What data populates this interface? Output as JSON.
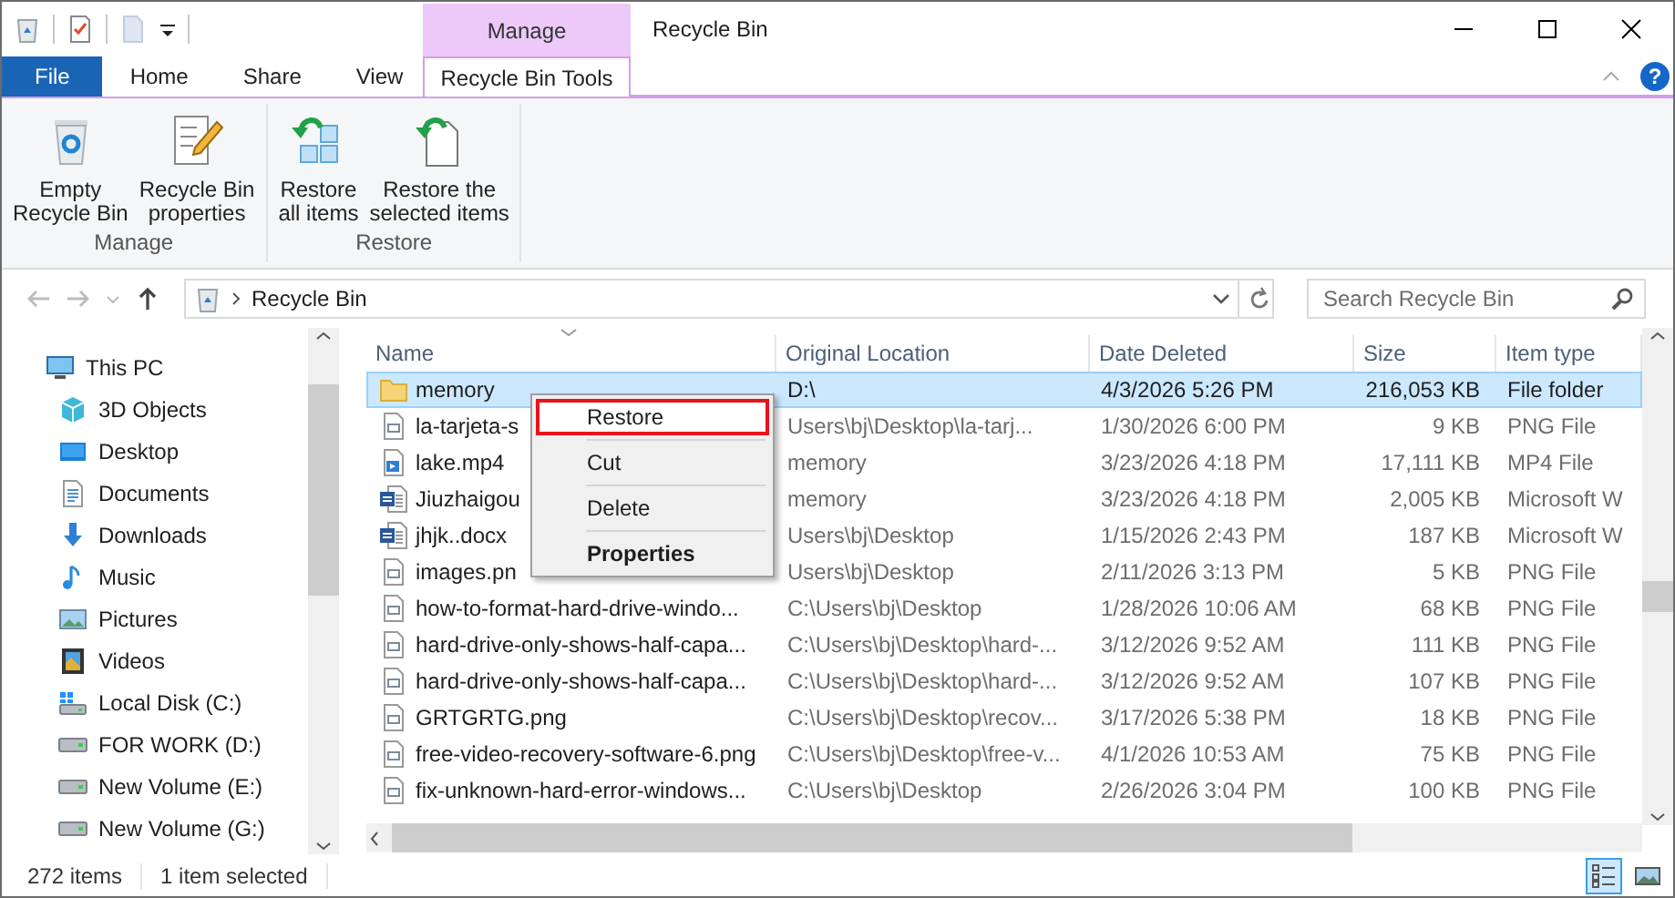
{
  "window": {
    "title": "Recycle Bin"
  },
  "ribbon_tabs": [
    {
      "label": "File",
      "kind": "file",
      "selected": false
    },
    {
      "label": "Home",
      "kind": "tab",
      "selected": false
    },
    {
      "label": "Share",
      "kind": "tab",
      "selected": false
    },
    {
      "label": "View",
      "kind": "tab",
      "selected": false
    }
  ],
  "contextual_tabs": {
    "header": "Manage",
    "tabs": [
      {
        "label": "Recycle Bin Tools",
        "selected": true
      }
    ]
  },
  "help": "?",
  "ribbon_groups": [
    {
      "label": "Manage",
      "buttons": [
        {
          "label": "Empty\nRecycle Bin",
          "kind": "empty"
        },
        {
          "label": "Recycle Bin\nproperties",
          "kind": "properties"
        }
      ]
    },
    {
      "label": "Restore",
      "buttons": [
        {
          "label": "Restore\nall items",
          "kind": "restore-all"
        },
        {
          "label": "Restore the\nselected items",
          "kind": "restore-selected"
        }
      ]
    }
  ],
  "address": {
    "path": "Recycle Bin"
  },
  "search": {
    "placeholder": "Search Recycle Bin"
  },
  "navigation": {
    "items": [
      {
        "label": "This PC",
        "kind": "computer",
        "children": [
          {
            "label": "3D Objects",
            "kind": "objects"
          },
          {
            "label": "Desktop",
            "kind": "desktop"
          },
          {
            "label": "Documents",
            "kind": "documents"
          },
          {
            "label": "Downloads",
            "kind": "downloads"
          },
          {
            "label": "Music",
            "kind": "music"
          },
          {
            "label": "Pictures",
            "kind": "pictures"
          },
          {
            "label": "Videos",
            "kind": "videos"
          },
          {
            "label": "Local Disk (C:)",
            "kind": "system-drive"
          },
          {
            "label": "FOR WORK (D:)",
            "kind": "drive"
          },
          {
            "label": "New Volume (E:)",
            "kind": "drive"
          },
          {
            "label": "New Volume (G:)",
            "kind": "drive"
          }
        ]
      }
    ]
  },
  "table": {
    "columns": [
      {
        "label": "Name",
        "kind": "text",
        "sorted": true
      },
      {
        "label": "Original Location",
        "kind": "text",
        "sorted": false
      },
      {
        "label": "Date Deleted",
        "kind": "text",
        "sorted": false
      },
      {
        "label": "Size",
        "kind": "number",
        "sorted": false
      },
      {
        "label": "Item type",
        "kind": "text",
        "sorted": false
      }
    ],
    "rows": [
      {
        "kind": "folder",
        "selected": true,
        "cells": [
          "memory",
          "D:\\",
          "4/3/2026 5:26 PM",
          "216,053 KB",
          "File folder"
        ]
      },
      {
        "kind": "image",
        "selected": false,
        "cells": [
          "la-tarjeta-s",
          "Users\\bj\\Desktop\\la-tarj...",
          "1/30/2026 6:00 PM",
          "9 KB",
          "PNG File"
        ]
      },
      {
        "kind": "video",
        "selected": false,
        "cells": [
          "lake.mp4",
          "memory",
          "3/23/2026 4:18 PM",
          "17,111 KB",
          "MP4 File"
        ]
      },
      {
        "kind": "word",
        "selected": false,
        "cells": [
          "Jiuzhaigou",
          "memory",
          "3/23/2026 4:18 PM",
          "2,005 KB",
          "Microsoft W"
        ]
      },
      {
        "kind": "word",
        "selected": false,
        "cells": [
          "jhjk..docx",
          "Users\\bj\\Desktop",
          "1/15/2026 2:43 PM",
          "187 KB",
          "Microsoft W"
        ]
      },
      {
        "kind": "image",
        "selected": false,
        "cells": [
          "images.pn",
          "Users\\bj\\Desktop",
          "2/11/2026 3:13 PM",
          "5 KB",
          "PNG File"
        ]
      },
      {
        "kind": "image",
        "selected": false,
        "cells": [
          "how-to-format-hard-drive-windo...",
          "C:\\Users\\bj\\Desktop",
          "1/28/2026 10:06 AM",
          "68 KB",
          "PNG File"
        ]
      },
      {
        "kind": "image",
        "selected": false,
        "cells": [
          "hard-drive-only-shows-half-capa...",
          "C:\\Users\\bj\\Desktop\\hard-...",
          "3/12/2026 9:52 AM",
          "111 KB",
          "PNG File"
        ]
      },
      {
        "kind": "image",
        "selected": false,
        "cells": [
          "hard-drive-only-shows-half-capa...",
          "C:\\Users\\bj\\Desktop\\hard-...",
          "3/12/2026 9:52 AM",
          "107 KB",
          "PNG File"
        ]
      },
      {
        "kind": "image",
        "selected": false,
        "cells": [
          "GRTGRTG.png",
          "C:\\Users\\bj\\Desktop\\recov...",
          "3/17/2026 5:38 PM",
          "18 KB",
          "PNG File"
        ]
      },
      {
        "kind": "image",
        "selected": false,
        "cells": [
          "free-video-recovery-software-6.png",
          "C:\\Users\\bj\\Desktop\\free-v...",
          "4/1/2026 10:53 AM",
          "75 KB",
          "PNG File"
        ]
      },
      {
        "kind": "image",
        "selected": false,
        "cells": [
          "fix-unknown-hard-error-windows...",
          "C:\\Users\\bj\\Desktop",
          "2/26/2026 3:04 PM",
          "100 KB",
          "PNG File"
        ]
      }
    ]
  },
  "context_menu": {
    "items": [
      {
        "label": "Restore",
        "selected": true,
        "default": false
      },
      {
        "label": "Cut",
        "selected": false,
        "default": false
      },
      {
        "label": "Delete",
        "selected": false,
        "default": false
      },
      {
        "label": "Properties",
        "selected": false,
        "default": true
      }
    ]
  },
  "status_bar": {
    "items": [
      "272 items",
      "1 item selected"
    ],
    "view_buttons": [
      {
        "kind": "details",
        "selected": true
      },
      {
        "kind": "large-icons",
        "selected": false
      }
    ]
  }
}
